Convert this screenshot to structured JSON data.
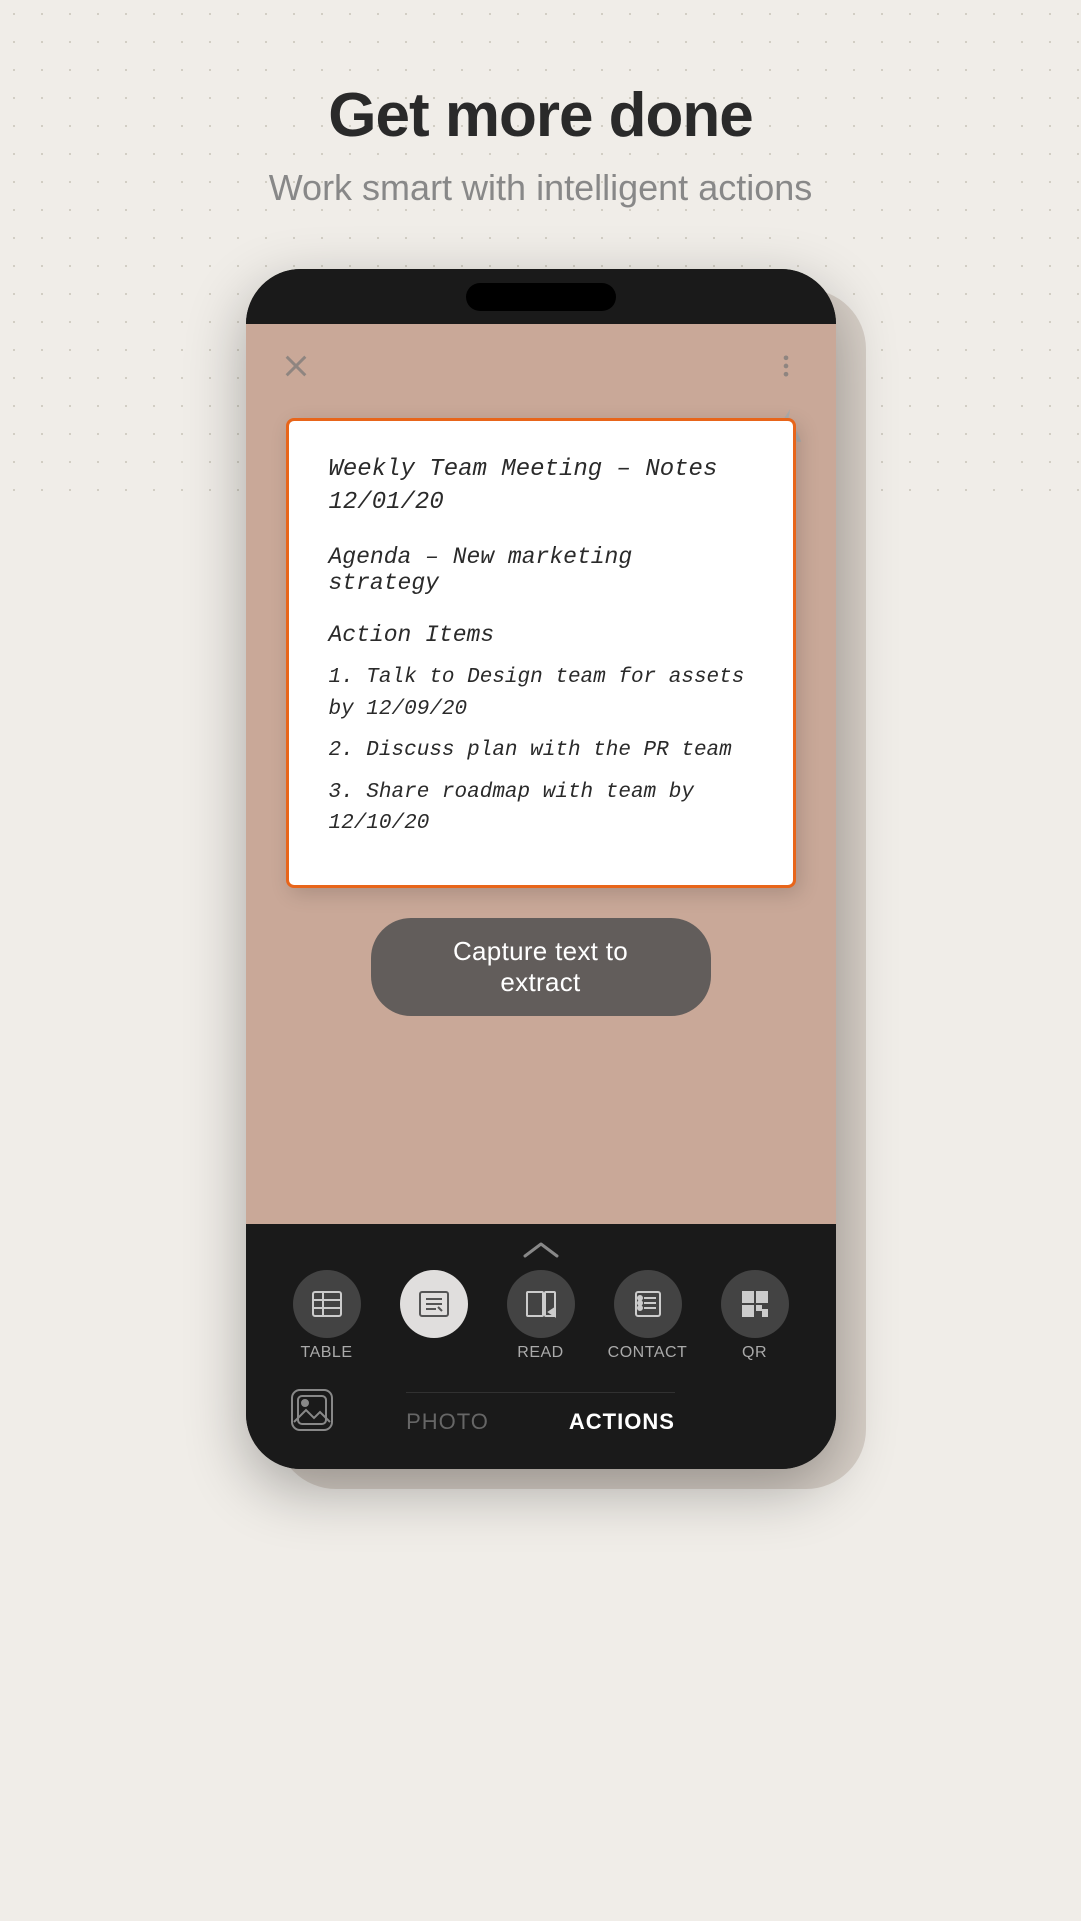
{
  "header": {
    "main_title": "Get more done",
    "sub_title": "Work smart with intelligent actions"
  },
  "document": {
    "title": "Weekly Team Meeting – Notes",
    "date": "12/01/20",
    "agenda": "Agenda – New marketing strategy",
    "section": "Action Items",
    "items": [
      "1. Talk to Design team for assets by 12/09/20",
      "2. Discuss plan with the PR team",
      "3. Share roadmap with team by 12/10/20"
    ]
  },
  "capture_button": "Capture text to extract",
  "bottom_icons": [
    {
      "id": "table",
      "label": "TABLE",
      "active": false
    },
    {
      "id": "text",
      "label": "",
      "active": true
    },
    {
      "id": "read",
      "label": "READ",
      "active": false
    },
    {
      "id": "contact",
      "label": "CONTACT",
      "active": false
    },
    {
      "id": "qr",
      "label": "QR",
      "active": false
    }
  ],
  "tabs": [
    {
      "id": "photo",
      "label": "PHOTO",
      "active": false
    },
    {
      "id": "actions",
      "label": "ACTIONS",
      "active": true
    }
  ],
  "icons": {
    "close": "✕",
    "more": "⋮",
    "chevron_up": "∧",
    "gallery": "⊡"
  }
}
